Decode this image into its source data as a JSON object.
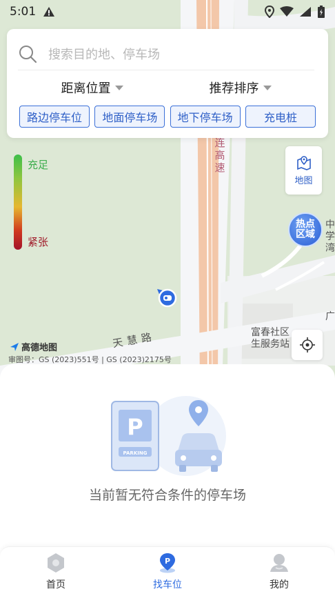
{
  "status_bar": {
    "time": "5:01",
    "icons": [
      "alert-icon",
      "location-icon",
      "wifi-icon",
      "signal-icon",
      "battery-icon"
    ]
  },
  "search": {
    "placeholder": "搜索目的地、停车场",
    "icon": "search-icon"
  },
  "sort": {
    "distance_label": "距离位置",
    "recommend_label": "推荐排序"
  },
  "filters": [
    "路边停车位",
    "地面停车场",
    "地下停车场",
    "充电桩"
  ],
  "legend": {
    "top": "充足",
    "bottom": "紧张",
    "colors": [
      "#3dbf4a",
      "#e6b730",
      "#a3142a"
    ]
  },
  "map": {
    "map_button_label": "地图",
    "hot_zone_line1": "热点",
    "hot_zone_line2": "区域",
    "road_label_1": "天慧路",
    "road_label_2": "连高速",
    "poi_label_1_line1": "富春社区",
    "poi_label_1_line2": "生服务站",
    "poi_label_2": "中学湾",
    "poi_label_3": "广",
    "brand": "高德地图",
    "copyright": "审图号：GS (2023)551号 | GS (2023)2175号"
  },
  "empty_state": {
    "message": "当前暂无符合条件的停车场",
    "parking_sign_text": "PARKING"
  },
  "tabs": [
    {
      "label": "首页",
      "icon": "home-icon",
      "active": false
    },
    {
      "label": "找车位",
      "icon": "parking-pin-icon",
      "active": true
    },
    {
      "label": "我的",
      "icon": "profile-icon",
      "active": false
    }
  ],
  "colors": {
    "accent": "#2e6be0",
    "chip_border": "#3a6fd8",
    "map_green": "#dfe9d8"
  }
}
